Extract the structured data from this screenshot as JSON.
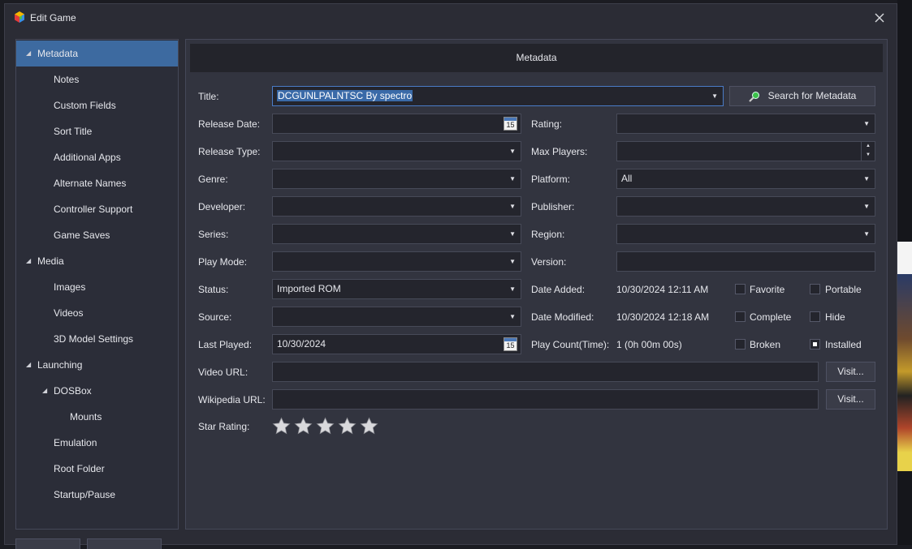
{
  "window": {
    "title": "Edit Game"
  },
  "sidebar": {
    "items": [
      {
        "label": "Metadata",
        "level": 0,
        "expanded": true,
        "selected": true
      },
      {
        "label": "Notes",
        "level": 1
      },
      {
        "label": "Custom Fields",
        "level": 1
      },
      {
        "label": "Sort Title",
        "level": 1
      },
      {
        "label": "Additional Apps",
        "level": 1
      },
      {
        "label": "Alternate Names",
        "level": 1
      },
      {
        "label": "Controller Support",
        "level": 1
      },
      {
        "label": "Game Saves",
        "level": 1
      },
      {
        "label": "Media",
        "level": 0,
        "expanded": true
      },
      {
        "label": "Images",
        "level": 1
      },
      {
        "label": "Videos",
        "level": 1
      },
      {
        "label": "3D Model Settings",
        "level": 1
      },
      {
        "label": "Launching",
        "level": 0,
        "expanded": true
      },
      {
        "label": "DOSBox",
        "level": 1,
        "expanded": true
      },
      {
        "label": "Mounts",
        "level": 2
      },
      {
        "label": "Emulation",
        "level": 1
      },
      {
        "label": "Root Folder",
        "level": 1
      },
      {
        "label": "Startup/Pause",
        "level": 1
      }
    ]
  },
  "metadata": {
    "header": "Metadata",
    "title_label": "Title:",
    "title_value": "DCGUNLPALNTSC By spectro",
    "search_button": "Search for Metadata",
    "release_date_label": "Release Date:",
    "release_date_value": "",
    "rating_label": "Rating:",
    "rating_value": "",
    "release_type_label": "Release Type:",
    "release_type_value": "",
    "max_players_label": "Max Players:",
    "max_players_value": "",
    "genre_label": "Genre:",
    "genre_value": "",
    "platform_label": "Platform:",
    "platform_value": "All",
    "developer_label": "Developer:",
    "developer_value": "",
    "publisher_label": "Publisher:",
    "publisher_value": "",
    "series_label": "Series:",
    "series_value": "",
    "region_label": "Region:",
    "region_value": "",
    "play_mode_label": "Play Mode:",
    "play_mode_value": "",
    "version_label": "Version:",
    "version_value": "",
    "status_label": "Status:",
    "status_value": "Imported ROM",
    "date_added_label": "Date Added:",
    "date_added_value": "10/30/2024 12:11 AM",
    "source_label": "Source:",
    "source_value": "",
    "date_modified_label": "Date Modified:",
    "date_modified_value": "10/30/2024 12:18 AM",
    "last_played_label": "Last Played:",
    "last_played_value": "10/30/2024",
    "play_count_label": "Play Count(Time):",
    "play_count_value": "1 (0h 00m 00s)",
    "video_url_label": "Video URL:",
    "video_url_value": "",
    "wikipedia_url_label": "Wikipedia URL:",
    "wikipedia_url_value": "",
    "visit_label": "Visit...",
    "star_rating_label": "Star Rating:",
    "star_rating_value": 0,
    "star_count": 5,
    "calendar_day": "15",
    "checkboxes": {
      "favorite": {
        "label": "Favorite",
        "checked": false
      },
      "portable": {
        "label": "Portable",
        "checked": false
      },
      "complete": {
        "label": "Complete",
        "checked": false
      },
      "hide": {
        "label": "Hide",
        "checked": false
      },
      "broken": {
        "label": "Broken",
        "checked": false
      },
      "installed": {
        "label": "Installed",
        "checked": true
      }
    }
  },
  "colors": {
    "accent": "#3d6aa0",
    "background": "#2b2c35",
    "field": "#24252d"
  }
}
